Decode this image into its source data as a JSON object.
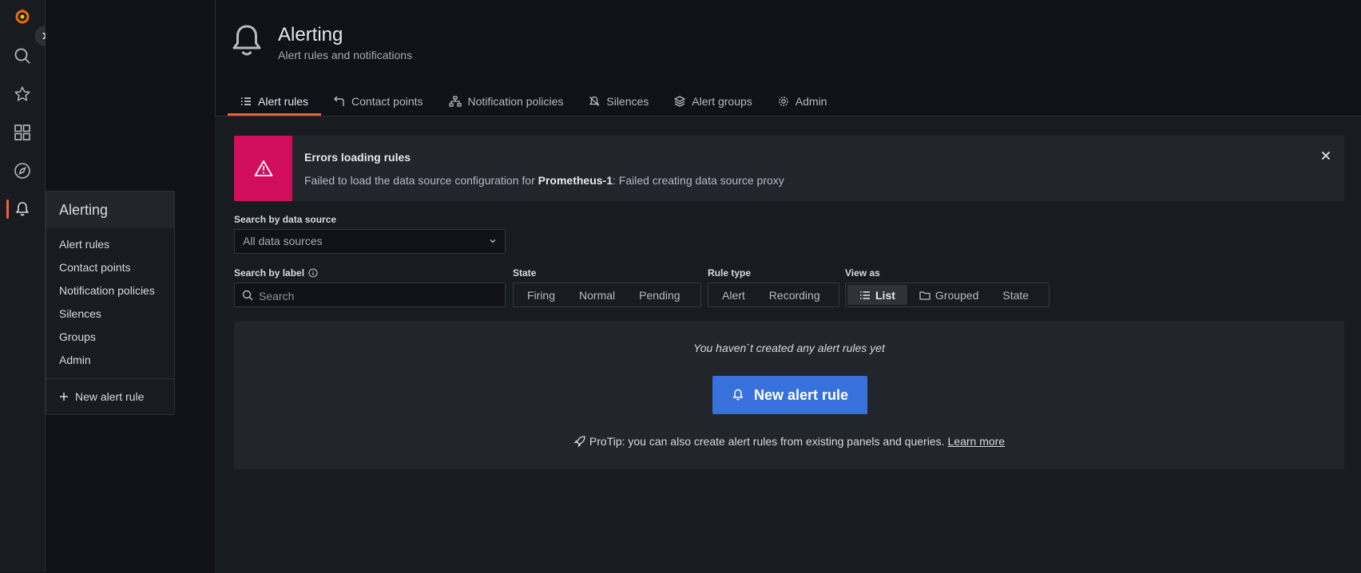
{
  "sidemenu": {
    "icons": [
      "grafana-logo-icon",
      "search-icon",
      "star-icon",
      "dashboards-icon",
      "explore-icon",
      "bell-icon"
    ],
    "accent": "#f55f3e"
  },
  "flyout": {
    "title": "Alerting",
    "items": [
      "Alert rules",
      "Contact points",
      "Notification policies",
      "Silences",
      "Groups",
      "Admin"
    ],
    "new_label": "New alert rule"
  },
  "header": {
    "title": "Alerting",
    "subtitle": "Alert rules and notifications"
  },
  "tabs": [
    {
      "label": "Alert rules",
      "icon": "list-icon",
      "active": true
    },
    {
      "label": "Contact points",
      "icon": "contact-points-icon",
      "active": false
    },
    {
      "label": "Notification policies",
      "icon": "sitemap-icon",
      "active": false
    },
    {
      "label": "Silences",
      "icon": "bell-slash-icon",
      "active": false
    },
    {
      "label": "Alert groups",
      "icon": "layer-group-icon",
      "active": false
    },
    {
      "label": "Admin",
      "icon": "cog-icon",
      "active": false
    }
  ],
  "error_alert": {
    "title": "Errors loading rules",
    "body_prefix": "Failed to load the data source configuration for ",
    "body_bold": "Prometheus-1",
    "body_suffix": ": Failed creating data source proxy",
    "color": "#d10e5c"
  },
  "filters": {
    "datasource_label": "Search by data source",
    "datasource_value": "All data sources",
    "label_label": "Search by label",
    "search_placeholder": "Search",
    "state_label": "State",
    "state_options": [
      "Firing",
      "Normal",
      "Pending"
    ],
    "ruletype_label": "Rule type",
    "ruletype_options": [
      "Alert",
      "Recording"
    ],
    "viewas_label": "View as",
    "viewas_options": [
      "List",
      "Grouped",
      "State"
    ],
    "viewas_selected": "List"
  },
  "empty_state": {
    "message": "You haven`t created any alert rules yet",
    "button_label": "New alert rule",
    "button_color": "#3871dc",
    "protip": "ProTip: you can also create alert rules from existing panels and queries.",
    "learn_more": "Learn more"
  }
}
